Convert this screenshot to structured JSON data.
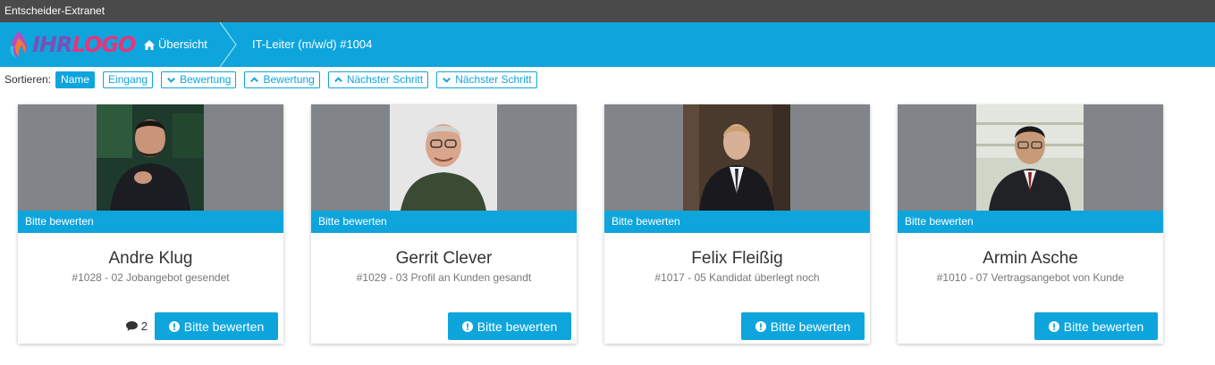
{
  "window": {
    "title": "Entscheider-Extranet"
  },
  "navbar": {
    "logo": {
      "part1": "IHR",
      "part2": "LOGO"
    },
    "breadcrumb": {
      "home_label": "Übersicht",
      "current_label": "IT-Leiter (m/w/d) #1004"
    }
  },
  "sortbar": {
    "label": "Sortieren:",
    "buttons": [
      {
        "label": "Name",
        "active": true,
        "icon": ""
      },
      {
        "label": "Eingang",
        "active": false,
        "icon": ""
      },
      {
        "label": "Bewertung",
        "active": false,
        "icon": "chevron-down-icon"
      },
      {
        "label": "Bewertung",
        "active": false,
        "icon": "chevron-up-icon"
      },
      {
        "label": "Nächster Schritt",
        "active": false,
        "icon": "chevron-up-icon"
      },
      {
        "label": "Nächster Schritt",
        "active": false,
        "icon": "chevron-down-icon"
      }
    ]
  },
  "cards": [
    {
      "banner": "Bitte bewerten",
      "name": "Andre Klug",
      "subtitle": "#1028 - 02 Jobangebot gesendet",
      "comments": "2",
      "button_label": "Bitte bewerten"
    },
    {
      "banner": "Bitte bewerten",
      "name": "Gerrit Clever",
      "subtitle": "#1029 - 03 Profil an Kunden gesandt",
      "comments": "",
      "button_label": "Bitte bewerten"
    },
    {
      "banner": "Bitte bewerten",
      "name": "Felix Fleißig",
      "subtitle": "#1017 - 05 Kandidat überlegt noch",
      "comments": "",
      "button_label": "Bitte bewerten"
    },
    {
      "banner": "Bitte bewerten",
      "name": "Armin Asche",
      "subtitle": "#1010 - 07 Vertragsangebot von Kunde",
      "comments": "",
      "button_label": "Bitte bewerten"
    }
  ],
  "colors": {
    "accent": "#0ea5dd",
    "titlebar": "#4a4a4a",
    "photo_bg": "#818589"
  }
}
